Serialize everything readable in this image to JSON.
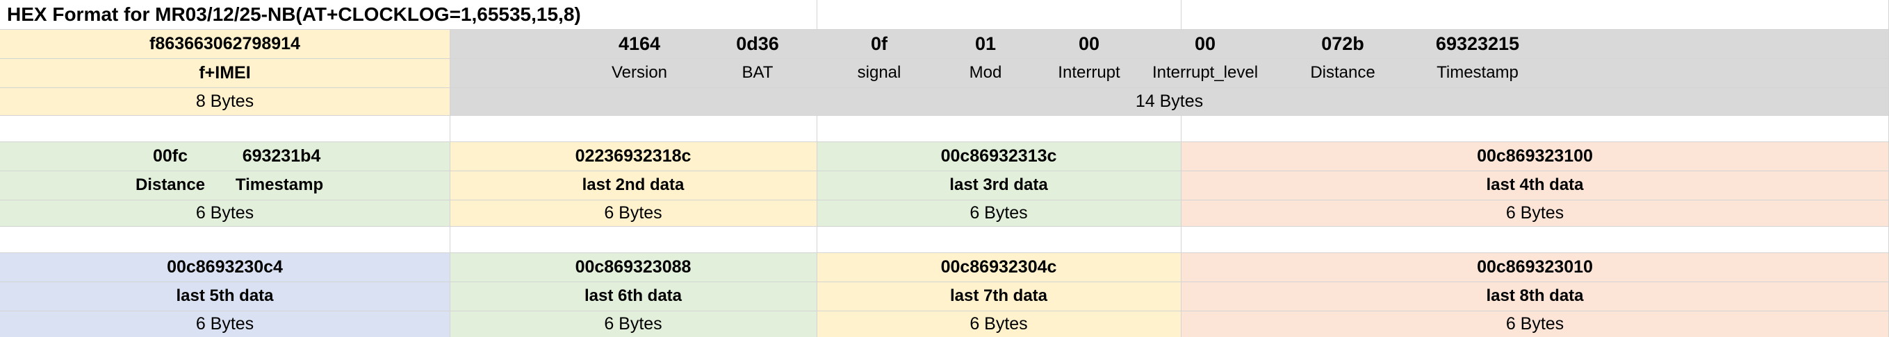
{
  "title": "HEX Format for MR03/12/25-NB(AT+CLOCKLOG=1,65535,15,8)",
  "header_row": {
    "imei_value": "f863663062798914",
    "imei_label": "f+IMEI",
    "imei_bytes": "8 Bytes",
    "fields": [
      {
        "value": "4164",
        "label": "Version"
      },
      {
        "value": "0d36",
        "label": "BAT"
      },
      {
        "value": "0f",
        "label": "signal"
      },
      {
        "value": "01",
        "label": "Mod"
      },
      {
        "value": "00",
        "label": "Interrupt"
      },
      {
        "value": "00",
        "label": "Interrupt_level"
      },
      {
        "value": "072b",
        "label": "Distance"
      },
      {
        "value": "69323215",
        "label": "Timestamp"
      }
    ],
    "fields_bytes": "14 Bytes"
  },
  "row2": {
    "first": {
      "distance_value": "00fc",
      "timestamp_value": "693231b4",
      "distance_label": "Distance",
      "timestamp_label": "Timestamp",
      "bytes": "6 Bytes"
    },
    "cells": [
      {
        "value": "02236932318c",
        "label": "last 2nd data",
        "bytes": "6 Bytes"
      },
      {
        "value": "00c86932313c",
        "label": "last 3rd data",
        "bytes": "6 Bytes"
      },
      {
        "value": "00c869323100",
        "label": "last 4th data",
        "bytes": "6 Bytes"
      }
    ]
  },
  "row3": {
    "cells": [
      {
        "value": "00c8693230c4",
        "label": "last 5th data",
        "bytes": "6 Bytes"
      },
      {
        "value": "00c869323088",
        "label": "last 6th data",
        "bytes": "6 Bytes"
      },
      {
        "value": "00c86932304c",
        "label": "last 7th data",
        "bytes": "6 Bytes"
      },
      {
        "value": "00c869323010",
        "label": "last 8th data",
        "bytes": "6 Bytes"
      }
    ]
  },
  "colors": {
    "yellow": "#FFF2CC",
    "grey": "#D9D9D9",
    "green": "#E2EFDA",
    "peach": "#FCE4D6",
    "blue": "#D9E1F2",
    "gridline": "#D4D4D4"
  }
}
